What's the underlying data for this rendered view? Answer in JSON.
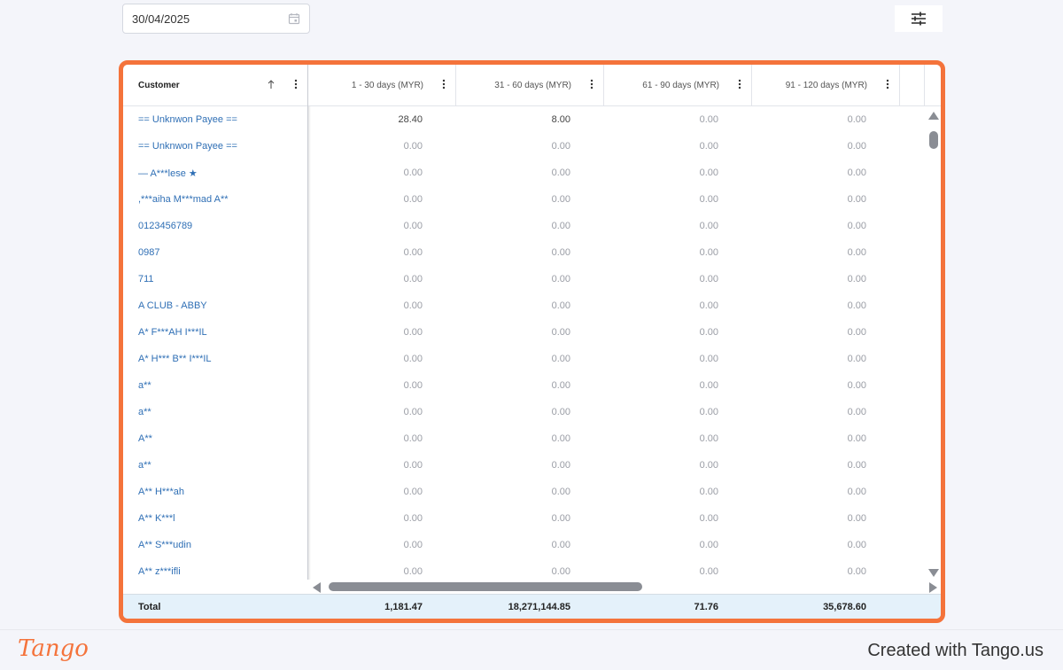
{
  "date_filter": {
    "value": "30/04/2025"
  },
  "grid": {
    "columns": [
      {
        "label": "Customer"
      },
      {
        "label": "1 - 30 days (MYR)"
      },
      {
        "label": "31 - 60 days (MYR)"
      },
      {
        "label": "61 - 90 days (MYR)"
      },
      {
        "label": "91 - 120 days (MYR)"
      }
    ],
    "rows": [
      {
        "customer": "== Unknwon Payee ==",
        "v1": "28.40",
        "v2": "8.00",
        "v3": "0.00",
        "v4": "0.00"
      },
      {
        "customer": "== Unknwon Payee ==",
        "v1": "0.00",
        "v2": "0.00",
        "v3": "0.00",
        "v4": "0.00"
      },
      {
        "customer": "— A***lese ★",
        "v1": "0.00",
        "v2": "0.00",
        "v3": "0.00",
        "v4": "0.00"
      },
      {
        "customer": ",***aiha M***mad A**",
        "v1": "0.00",
        "v2": "0.00",
        "v3": "0.00",
        "v4": "0.00"
      },
      {
        "customer": "0123456789",
        "v1": "0.00",
        "v2": "0.00",
        "v3": "0.00",
        "v4": "0.00"
      },
      {
        "customer": "0987",
        "v1": "0.00",
        "v2": "0.00",
        "v3": "0.00",
        "v4": "0.00"
      },
      {
        "customer": "711",
        "v1": "0.00",
        "v2": "0.00",
        "v3": "0.00",
        "v4": "0.00"
      },
      {
        "customer": "A CLUB - ABBY",
        "v1": "0.00",
        "v2": "0.00",
        "v3": "0.00",
        "v4": "0.00"
      },
      {
        "customer": "A* F***AH I***IL",
        "v1": "0.00",
        "v2": "0.00",
        "v3": "0.00",
        "v4": "0.00"
      },
      {
        "customer": "A* H*** B** I***IL",
        "v1": "0.00",
        "v2": "0.00",
        "v3": "0.00",
        "v4": "0.00"
      },
      {
        "customer": "a**",
        "v1": "0.00",
        "v2": "0.00",
        "v3": "0.00",
        "v4": "0.00"
      },
      {
        "customer": "a**",
        "v1": "0.00",
        "v2": "0.00",
        "v3": "0.00",
        "v4": "0.00"
      },
      {
        "customer": "A**",
        "v1": "0.00",
        "v2": "0.00",
        "v3": "0.00",
        "v4": "0.00"
      },
      {
        "customer": "a**",
        "v1": "0.00",
        "v2": "0.00",
        "v3": "0.00",
        "v4": "0.00"
      },
      {
        "customer": "A** H***ah",
        "v1": "0.00",
        "v2": "0.00",
        "v3": "0.00",
        "v4": "0.00"
      },
      {
        "customer": "A** K***l",
        "v1": "0.00",
        "v2": "0.00",
        "v3": "0.00",
        "v4": "0.00"
      },
      {
        "customer": "A** S***udin",
        "v1": "0.00",
        "v2": "0.00",
        "v3": "0.00",
        "v4": "0.00"
      },
      {
        "customer": "A** z***ifli",
        "v1": "0.00",
        "v2": "0.00",
        "v3": "0.00",
        "v4": "0.00"
      }
    ],
    "footer": {
      "label": "Total",
      "v1": "1,181.47",
      "v2": "18,271,144.85",
      "v3": "71.76",
      "v4": "35,678.60"
    }
  },
  "icons": {
    "calendar": "calendar-icon",
    "filter": "sliders-icon",
    "sort": "arrow-up-icon",
    "menu": "kebab-menu-icon"
  },
  "colors": {
    "highlight_border": "#f4733b",
    "customer_link": "#2f6fb5",
    "footer_bg": "#e4f1fa"
  },
  "branding": {
    "logo": "Tango",
    "created_with": "Created with Tango.us"
  }
}
